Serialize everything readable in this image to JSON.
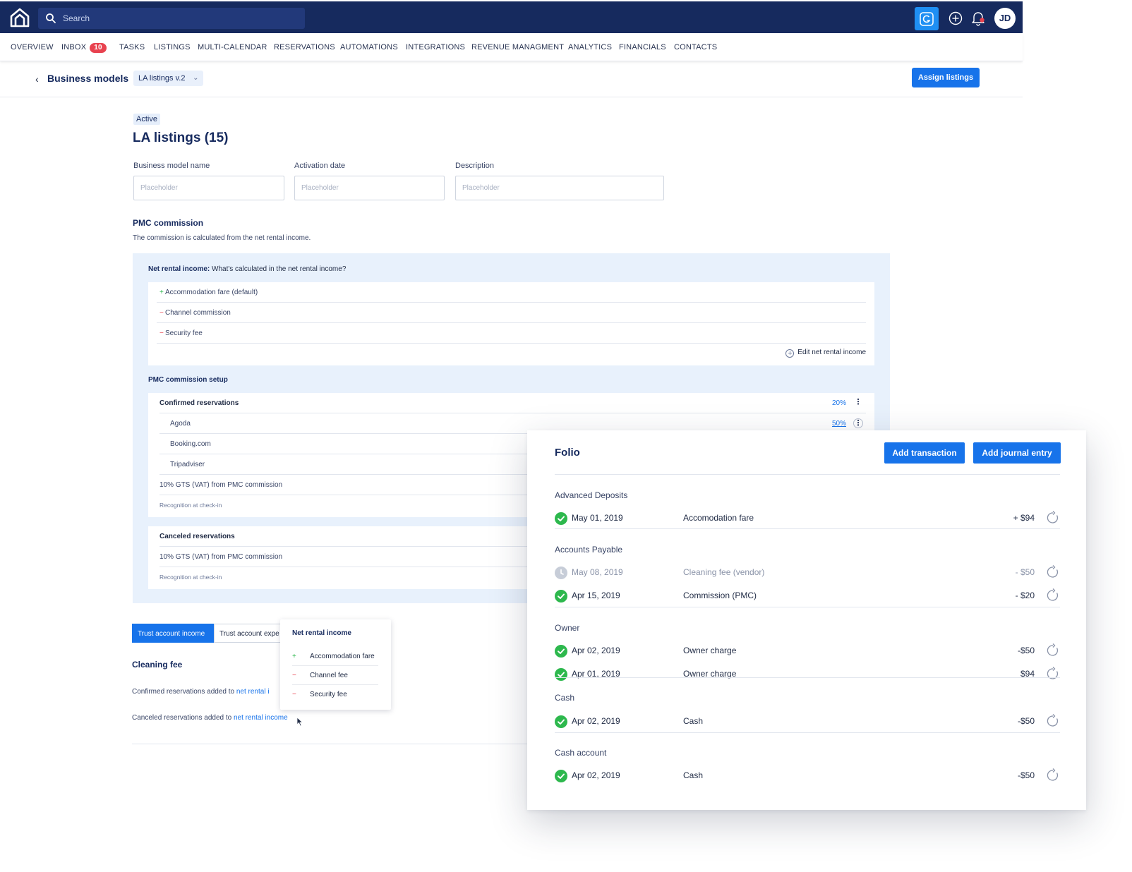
{
  "topbar": {
    "search_placeholder": "Search",
    "avatar_initials": "JD"
  },
  "nav": {
    "items": [
      "OVERVIEW",
      "INBOX",
      "TASKS",
      "LISTINGS",
      "MULTI-CALENDAR",
      "RESERVATIONS",
      "AUTOMATIONS",
      "INTEGRATIONS",
      "REVENUE MANAGMENT",
      "ANALYTICS",
      "FINANCIALS",
      "CONTACTS"
    ],
    "inbox_count": "10"
  },
  "subheader": {
    "back_icon": "chevron-left-icon",
    "title": "Business models",
    "version": "LA listings v.2",
    "assign_label": "Assign listings"
  },
  "model": {
    "status": "Active",
    "title": "LA listings (15)",
    "fields": [
      {
        "label": "Business model name",
        "placeholder": "Placeholder"
      },
      {
        "label": "Activation date",
        "placeholder": "Placeholder"
      },
      {
        "label": "Description",
        "placeholder": "Placeholder"
      }
    ]
  },
  "pmc": {
    "title": "PMC commission",
    "description": "The commission is calculated from the net rental income.",
    "nri_head_bold": "Net rental income:",
    "nri_head_rest": " What's calculated in the net rental income?",
    "nri_items": [
      {
        "sign": "+",
        "label": "Accommodation fare (default)"
      },
      {
        "sign": "−",
        "label": "Channel commission"
      },
      {
        "sign": "−",
        "label": "Security fee"
      }
    ],
    "edit_label": "Edit net rental income",
    "setup_title": "PMC commission setup",
    "confirmed": {
      "label": "Confirmed reservations",
      "percent": "20%",
      "channels": [
        {
          "name": "Agoda",
          "percent": "50%"
        },
        {
          "name": "Booking.com",
          "percent": ""
        },
        {
          "name": "Tripadviser",
          "percent": ""
        }
      ],
      "vat": "10% GTS (VAT) from PMC commission",
      "recognition": "Recognition at check-in"
    },
    "canceled": {
      "label": "Canceled reservations",
      "vat": "10% GTS (VAT) from PMC commission",
      "recognition": "Recognition at check-in"
    }
  },
  "tabs": {
    "active": "Trust account income",
    "second": "Trust account expe"
  },
  "cleaning": {
    "title": "Cleaning fee",
    "confirmed_text": "Confirmed reservations added to ",
    "confirmed_link": "net rental i",
    "canceled_text": "Canceled reservations added to ",
    "canceled_link": "net rental income"
  },
  "popover": {
    "title": "Net rental income",
    "items": [
      {
        "sign": "+",
        "label": "Accommodation fare"
      },
      {
        "sign": "−",
        "label": "Channel fee"
      },
      {
        "sign": "−",
        "label": "Security fee"
      }
    ]
  },
  "folio": {
    "title": "Folio",
    "add_transaction": "Add transaction",
    "add_journal": "Add journal entry",
    "sections": [
      {
        "name": "Advanced Deposits",
        "rows": [
          {
            "status": "done",
            "date": "May 01, 2019",
            "desc": "Accomodation fare",
            "amount": "+ $94"
          }
        ]
      },
      {
        "name": "Accounts Payable",
        "rows": [
          {
            "status": "pending",
            "date": "May 08, 2019",
            "desc": "Cleaning  fee (vendor)",
            "amount": "- $50"
          },
          {
            "status": "done",
            "date": "Apr 15, 2019",
            "desc": "Commission (PMC)",
            "amount": "- $20"
          }
        ]
      },
      {
        "name": "Owner",
        "rows": [
          {
            "status": "done",
            "date": "Apr 02, 2019",
            "desc": "Owner charge",
            "amount": "-$50"
          },
          {
            "status": "done",
            "date": "Apr 01, 2019",
            "desc": "Owner charge",
            "amount": "$94"
          }
        ]
      },
      {
        "name": "Cash",
        "rows": [
          {
            "status": "done",
            "date": "Apr 02, 2019",
            "desc": "Cash",
            "amount": "-$50"
          }
        ]
      },
      {
        "name": "Cash account",
        "rows": [
          {
            "status": "done",
            "date": "Apr 02, 2019",
            "desc": "Cash",
            "amount": "-$50"
          }
        ]
      }
    ]
  },
  "colors": {
    "topbar": "#162a5e",
    "primary": "#1773ea",
    "success": "#2db84d",
    "danger": "#e8424f",
    "panel": "#e8f1fc"
  }
}
